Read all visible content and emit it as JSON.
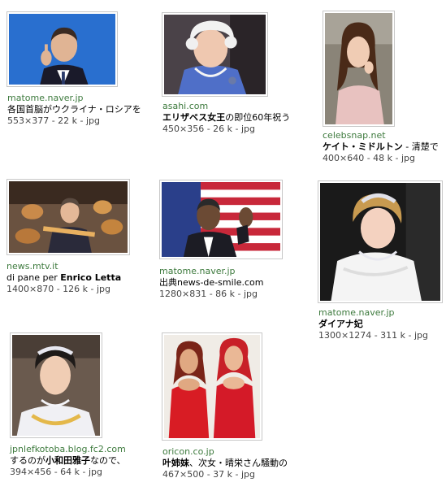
{
  "results": [
    {
      "source": "matome.naver.jp",
      "title_pre": "各国首脳がウクライナ・ロシアを",
      "title_bold": "",
      "title_post": "",
      "info": "553×377 - 22 k - jpg",
      "icon": "person-photo"
    },
    {
      "source": "asahi.com",
      "title_pre": "",
      "title_bold": "エリザベス女王",
      "title_post": "の即位60年祝う",
      "info": "450×356 - 26 k - jpg",
      "icon": "person-photo"
    },
    {
      "source": "celebsnap.net",
      "title_pre": "",
      "title_bold": "ケイト・ミドルトン",
      "title_post": " - 清楚で",
      "info": "400×640 - 48 k - jpg",
      "icon": "person-photo"
    },
    {
      "source": "news.mtv.it",
      "title_pre": "di pane per ",
      "title_bold": "Enrico Letta",
      "title_post": "",
      "info": "1400×870 - 126 k - jpg",
      "icon": "person-photo"
    },
    {
      "source": "matome.naver.jp",
      "title_pre": "出典news-de-smile.com",
      "title_bold": "",
      "title_post": "",
      "info": "1280×831 - 86 k - jpg",
      "icon": "person-photo"
    },
    {
      "source": "matome.naver.jp",
      "title_pre": "",
      "title_bold": "ダイアナ妃",
      "title_post": "",
      "info": "1300×1274 - 311 k - jpg",
      "icon": "person-photo"
    },
    {
      "source": "jpnlefkotoba.blog.fc2.com",
      "title_pre": "するのが",
      "title_bold": "小和田雅子",
      "title_post": "なので、",
      "info": "394×456 - 64 k - jpg",
      "icon": "person-photo"
    },
    {
      "source": "oricon.co.jp",
      "title_pre": "",
      "title_bold": "叶姉妹",
      "title_post": "、次女・晴栄さん騒動の",
      "info": "467×500 - 37 k - jpg",
      "icon": "person-photo"
    }
  ],
  "colors": {
    "source": "#3d7a3d",
    "border": "#c8c8c8"
  }
}
